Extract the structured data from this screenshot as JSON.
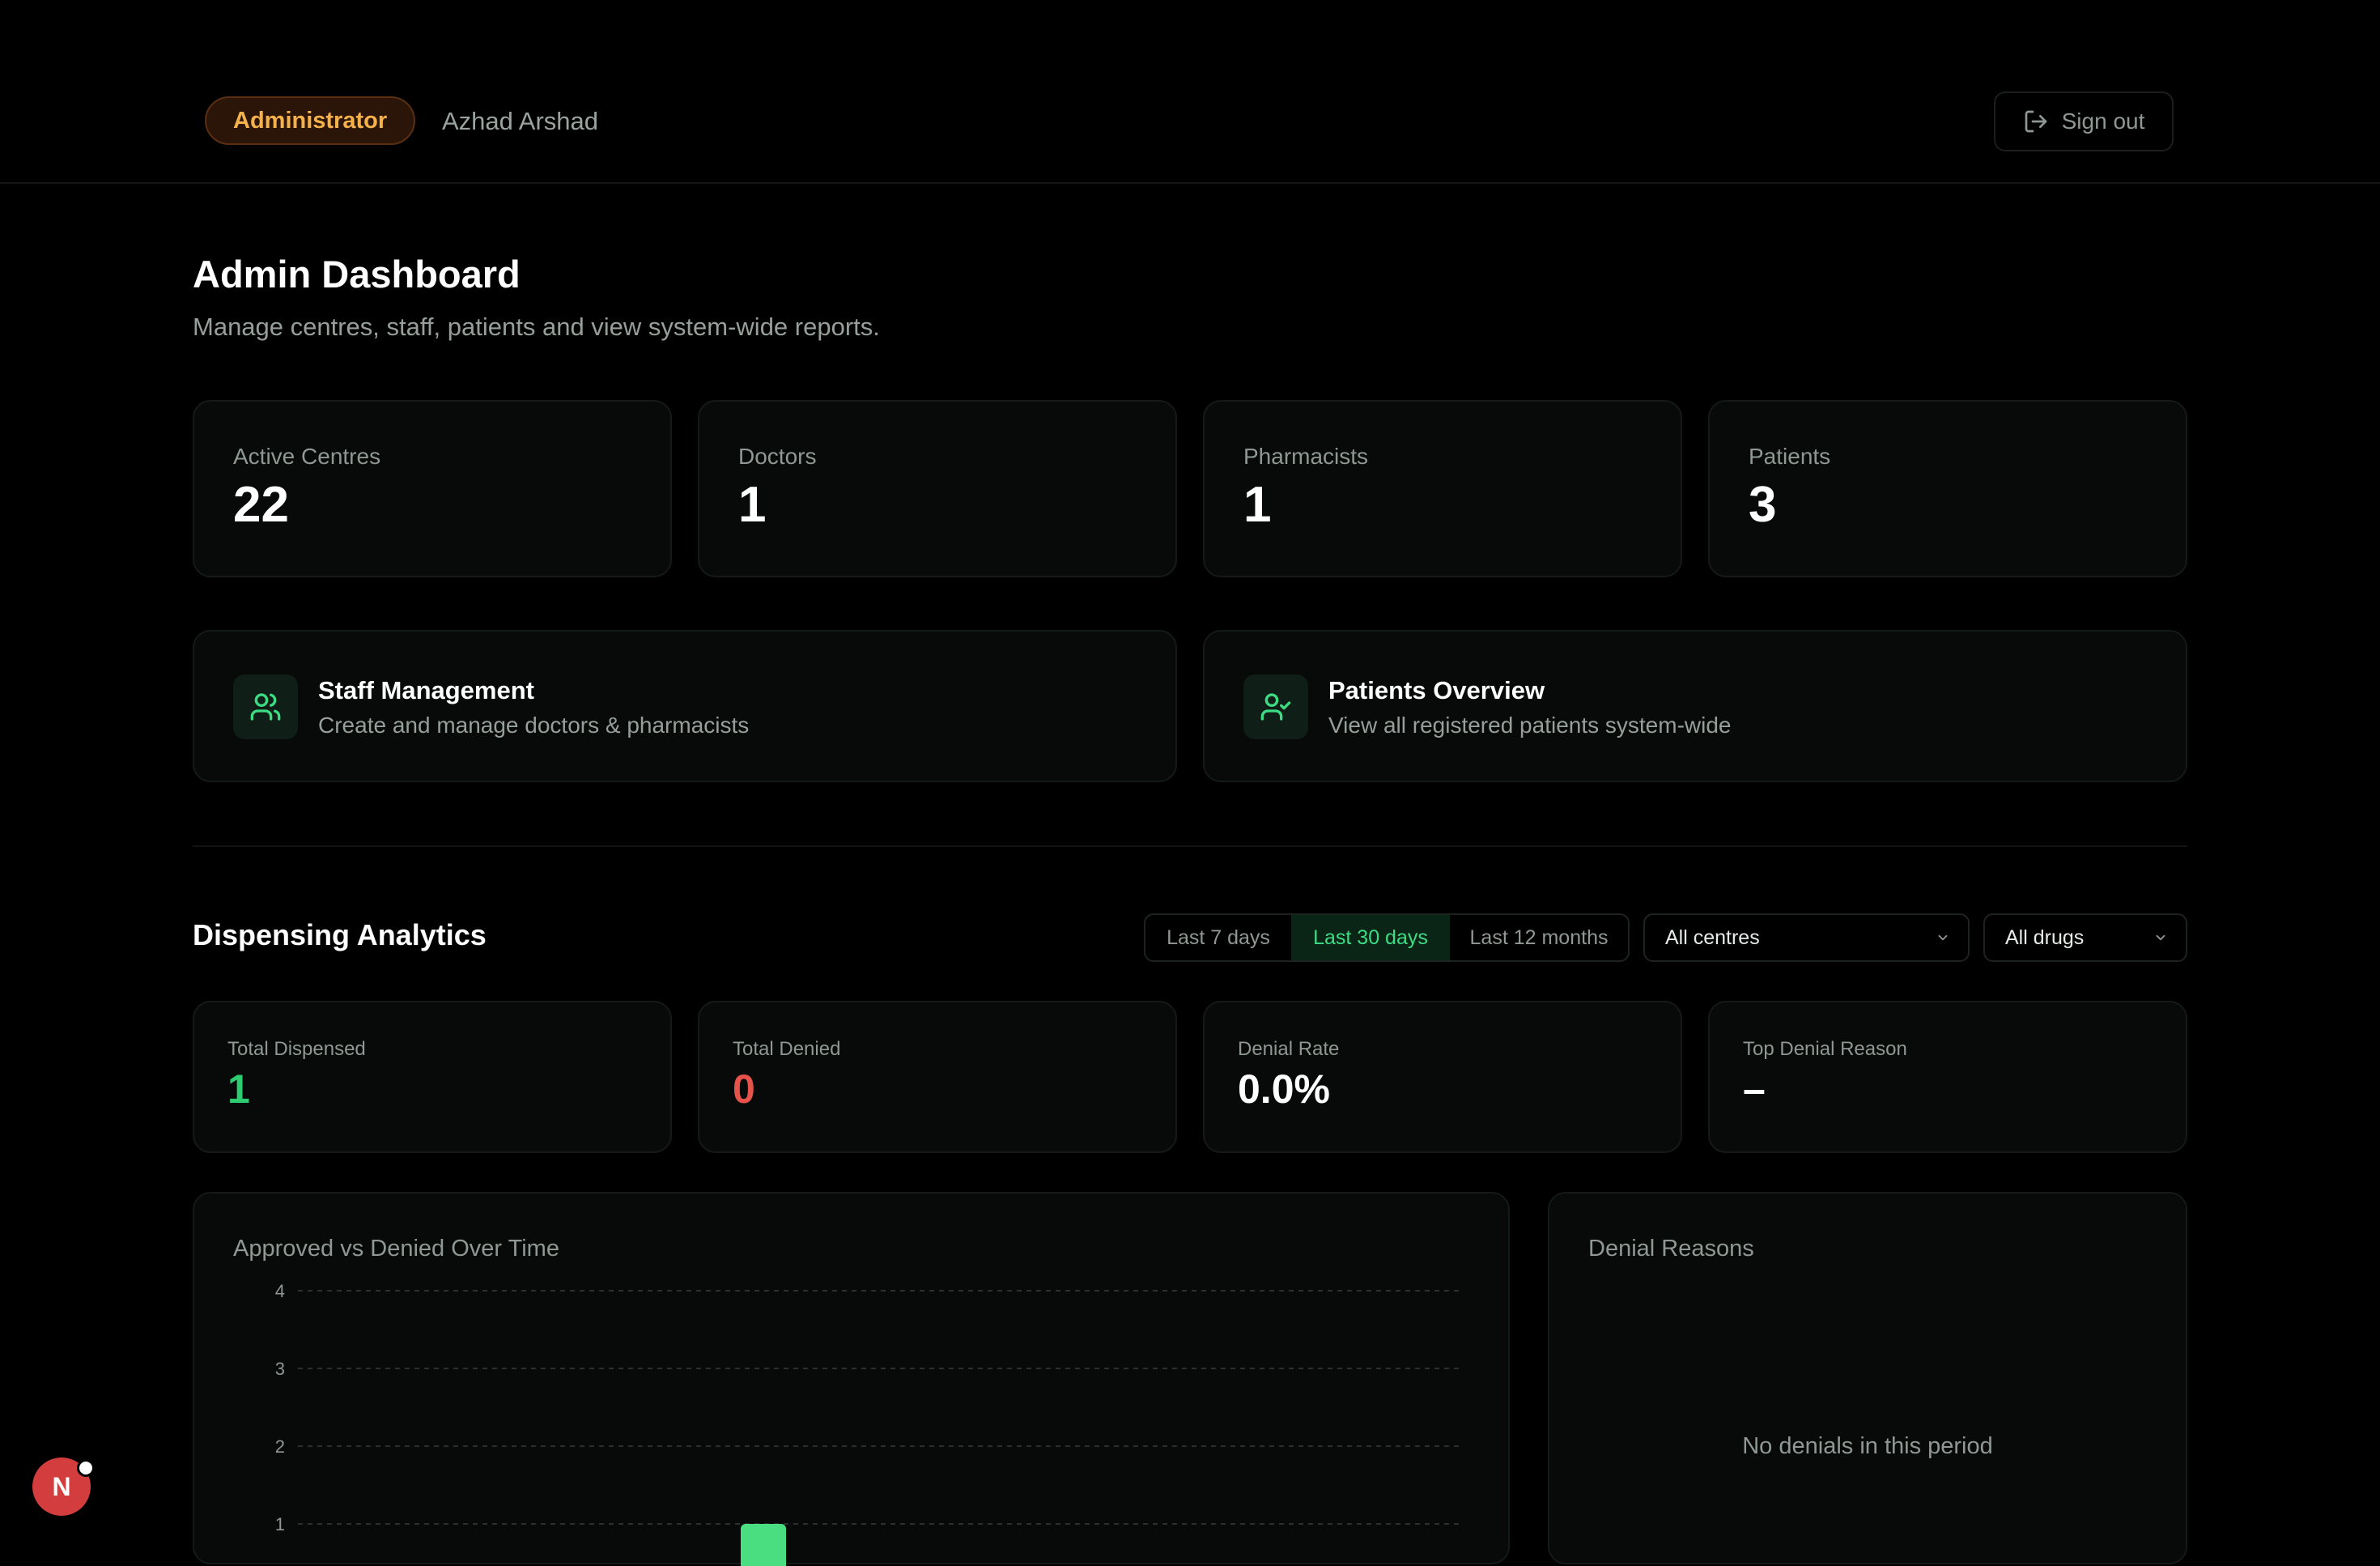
{
  "header": {
    "role": "Administrator",
    "user_name": "Azhad Arshad",
    "sign_out_label": "Sign out",
    "sign_out_icon": "log-out-icon"
  },
  "page": {
    "title": "Admin Dashboard",
    "subtitle": "Manage centres, staff, patients and view system-wide reports."
  },
  "stats": [
    {
      "label": "Active Centres",
      "value": "22"
    },
    {
      "label": "Doctors",
      "value": "1"
    },
    {
      "label": "Pharmacists",
      "value": "1"
    },
    {
      "label": "Patients",
      "value": "3"
    }
  ],
  "nav_cards": [
    {
      "title": "Staff Management",
      "desc": "Create and manage doctors & pharmacists",
      "icon": "users-icon"
    },
    {
      "title": "Patients Overview",
      "desc": "View all registered patients system-wide",
      "icon": "user-check-icon"
    }
  ],
  "analytics": {
    "title": "Dispensing Analytics",
    "ranges": [
      "Last 7 days",
      "Last 30 days",
      "Last 12 months"
    ],
    "active_range": "Last 30 days",
    "centre_select": "All centres",
    "drug_select": "All drugs"
  },
  "metrics": [
    {
      "label": "Total Dispensed",
      "value": "1",
      "color": "#2ecc71"
    },
    {
      "label": "Total Denied",
      "value": "0",
      "color": "#e5534b"
    },
    {
      "label": "Denial Rate",
      "value": "0.0%",
      "color": "#ffffff"
    },
    {
      "label": "Top Denial Reason",
      "value": "–",
      "color": "#ffffff"
    }
  ],
  "chart_data": {
    "type": "bar",
    "title": "Approved vs Denied Over Time",
    "yticks": [
      "4",
      "3",
      "2",
      "1"
    ],
    "ylim": [
      0,
      4
    ],
    "grid": true,
    "series": [
      {
        "values": [
          1
        ],
        "color": "#4ade80"
      }
    ]
  },
  "denials": {
    "title": "Denial Reasons",
    "empty_text": "No denials in this period"
  },
  "avatar": {
    "initial": "N",
    "color": "#d43d3d"
  }
}
